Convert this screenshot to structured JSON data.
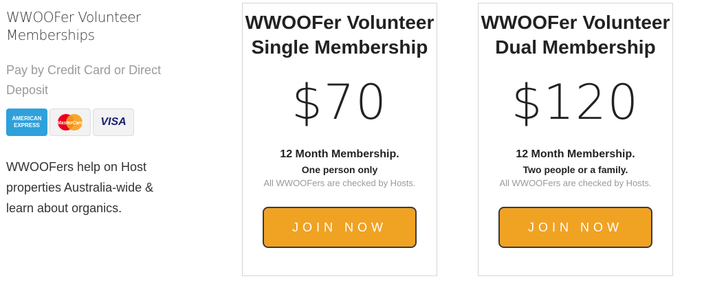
{
  "intro": {
    "title": "WWOOFer Volunteer Memberships",
    "payment_text": "Pay by Credit Card or Direct Deposit",
    "cards": [
      {
        "name": "amex-icon",
        "label_1": "AMERICAN",
        "label_2": "EXPRESS"
      },
      {
        "name": "mastercard-icon",
        "label": "MasterCard"
      },
      {
        "name": "visa-icon",
        "label": "VISA"
      }
    ],
    "description": "WWOOFers help on Host properties Australia-wide & learn about organics."
  },
  "plans": [
    {
      "title_line1": "WWOOFer Volunteer",
      "title_line2": "Single Membership",
      "price": "$70",
      "term": "12 Month Membership.",
      "who": "One person only",
      "note": "All WWOOFers are checked by Hosts.",
      "button": "JOIN NOW"
    },
    {
      "title_line1": "WWOOFer Volunteer",
      "title_line2": "Dual Membership",
      "price": "$120",
      "term": "12 Month Membership.",
      "who": "Two people or a family.",
      "note": "All WWOOFers are checked by Hosts.",
      "button": "JOIN NOW"
    }
  ],
  "colors": {
    "accent": "#f0a223",
    "amex": "#2ea1db",
    "mc_red": "#eb001b",
    "mc_orange": "#f79e1b",
    "visa": "#1a1f71"
  }
}
